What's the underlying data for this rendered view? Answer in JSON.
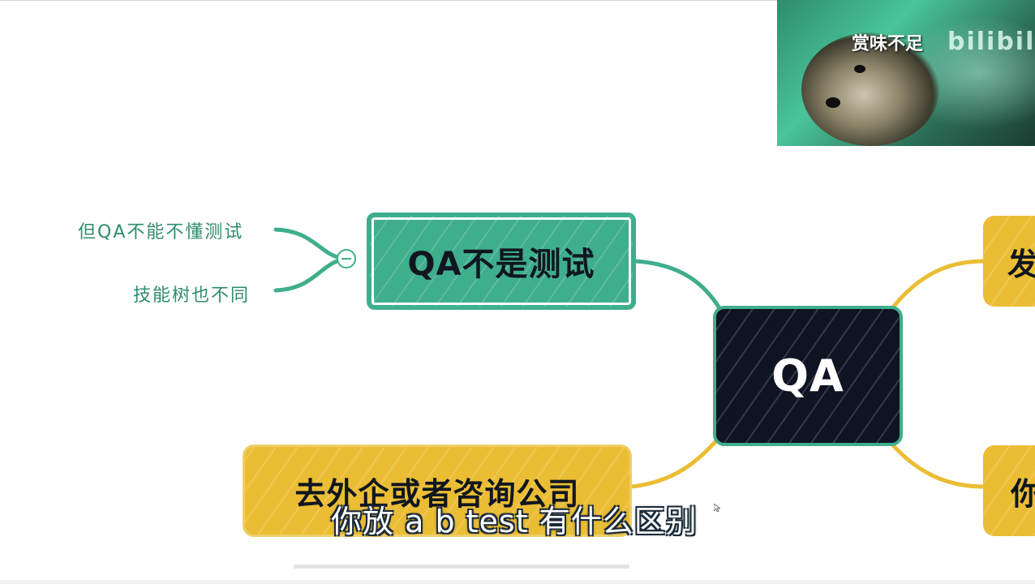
{
  "mindmap": {
    "center_node": {
      "label": "QA"
    },
    "branch_green": {
      "label": "QA不是测试"
    },
    "leaves": [
      {
        "label": "但QA不能不懂测试"
      },
      {
        "label": "技能树也不同"
      }
    ],
    "branch_yellow": {
      "label": "去外企或者咨询公司"
    },
    "branch_right_top": {
      "label": "发"
    },
    "branch_right_bottom": {
      "label": "你"
    }
  },
  "video_overlay": {
    "caption": "赏味不足",
    "watermark": "bilibili"
  },
  "subtitle": {
    "text": "你放 a b test 有什么区别"
  },
  "colors": {
    "green": "#3fae8d",
    "dark": "#0f1322",
    "yellow": "#ebbd34",
    "leaf_text": "#2f8c70"
  }
}
